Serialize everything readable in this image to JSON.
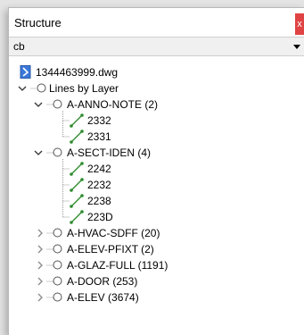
{
  "panel": {
    "title": "Structure",
    "close_glyph": "x"
  },
  "filter": {
    "value": "cb",
    "arrow_icon": "triangle-down-icon"
  },
  "tree": {
    "file": {
      "label": "1344463999.dwg",
      "icon": "dwg-file-icon"
    },
    "root": {
      "label": "Lines by Layer",
      "expanded": true
    },
    "layers": [
      {
        "label": "A-ANNO-NOTE (2)",
        "expanded": true,
        "items": [
          "2332",
          "2331"
        ]
      },
      {
        "label": "A-SECT-IDEN (4)",
        "expanded": true,
        "items": [
          "2242",
          "2232",
          "2238",
          "223D"
        ]
      },
      {
        "label": "A-HVAC-SDFF (20)",
        "expanded": false
      },
      {
        "label": "A-ELEV-PFIXT (2)",
        "expanded": false
      },
      {
        "label": "A-GLAZ-FULL (1191)",
        "expanded": false
      },
      {
        "label": "A-DOOR (253)",
        "expanded": false
      },
      {
        "label": "A-ELEV (3674)",
        "expanded": false
      }
    ]
  }
}
